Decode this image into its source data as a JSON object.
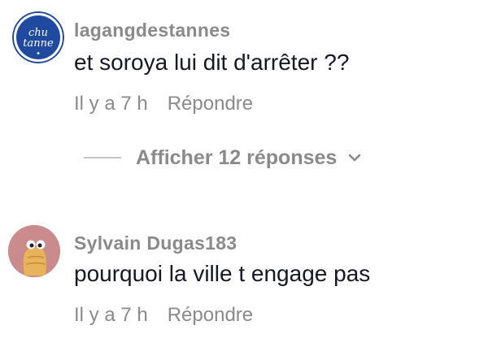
{
  "comments": [
    {
      "username": "lagangdestannes",
      "text": "et soroya lui dit d'arrêter ??",
      "time": "Il y a 7 h",
      "reply_label": "Répondre",
      "avatar_text_top": "chu",
      "avatar_text_bottom": "tanne",
      "avatar_bg": "#1f4aa0"
    },
    {
      "username": "Sylvain Dugas183",
      "text": "pourquoi la ville t engage pas",
      "time": "Il y a 7 h",
      "reply_label": "Répondre",
      "avatar_bg": "#c98b8b"
    }
  ],
  "replies_toggle": {
    "label": "Afficher 12 réponses",
    "icon": "chevron-down-icon"
  },
  "colors": {
    "muted": "#8a8a8a",
    "text": "#161823"
  }
}
